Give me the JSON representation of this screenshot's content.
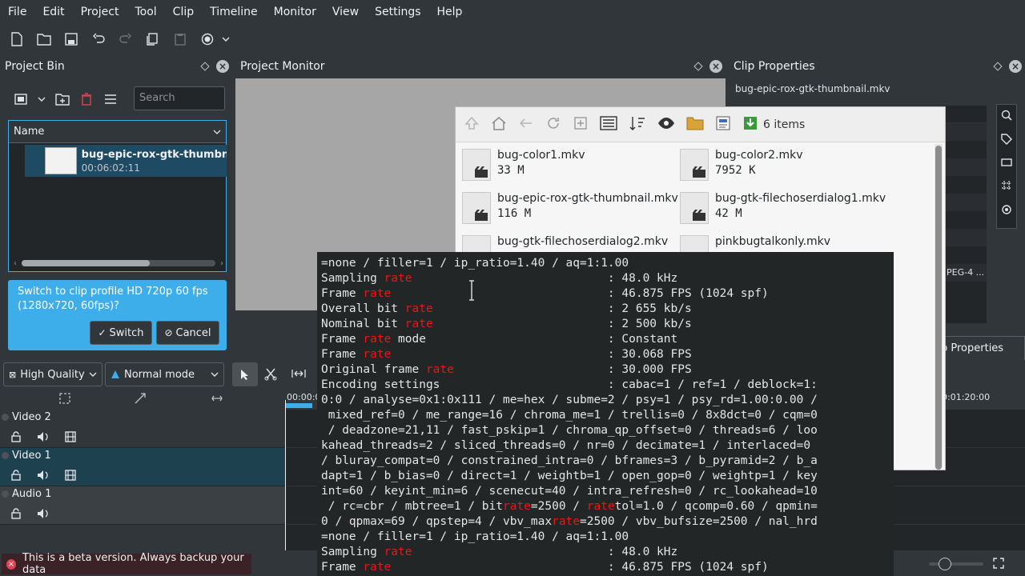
{
  "menu": [
    "File",
    "Edit",
    "Project",
    "Tool",
    "Clip",
    "Timeline",
    "Monitor",
    "View",
    "Settings",
    "Help"
  ],
  "project_bin": {
    "title": "Project Bin",
    "search_placeholder": "Search",
    "column_name": "Name",
    "clip_name": "bug-epic-rox-gtk-thumbnail",
    "clip_duration": "00:06:02:11",
    "profile_message": "Switch to clip profile HD 720p 60 fps (1280x720, 60fps)?",
    "switch_label": "Switch",
    "cancel_label": "Cancel"
  },
  "project_monitor": {
    "title": "Project Monitor"
  },
  "clip_properties": {
    "title": "Clip Properties",
    "filename": "bug-epic-rox-gtk-thumbnail.mkv",
    "tab_label": "p Properties",
    "codec_snippet": "PEG-4 ..."
  },
  "file_dialog": {
    "item_count": "6 items",
    "files": [
      {
        "name": "bug-color1.mkv",
        "size": "33 M"
      },
      {
        "name": "bug-color2.mkv",
        "size": "7952 K"
      },
      {
        "name": "bug-epic-rox-gtk-thumbnail.mkv",
        "size": "116 M"
      },
      {
        "name": "bug-gtk-filechoserdialog1.mkv",
        "size": "42 M"
      },
      {
        "name": "bug-gtk-filechoserdialog2.mkv",
        "size": ""
      },
      {
        "name": "pinkbugtalkonly.mkv",
        "size": ""
      }
    ]
  },
  "timeline": {
    "quality": "High Quality",
    "mode": "Normal mode",
    "ruler_start": "00:00:0",
    "ruler_end": "0:01:20:00",
    "tracks": [
      {
        "name": "Video 2"
      },
      {
        "name": "Video 1"
      },
      {
        "name": "Audio 1"
      }
    ]
  },
  "status": {
    "beta_message": "This is a beta version. Always backup your data"
  },
  "terminal": {
    "lines": [
      "=none / filler=1 / ip_ratio=1.40 / aq=1:1.00",
      "Sampling rate                            : 48.0 kHz",
      "Frame rate                               : 46.875 FPS (1024 spf)",
      "Overall bit rate                         : 2 655 kb/s",
      "Nominal bit rate                         : 2 500 kb/s",
      "Frame rate mode                          : Constant",
      "Frame rate                               : 30.068 FPS",
      "Original frame rate                      : 30.000 FPS",
      "Encoding settings                        : cabac=1 / ref=1 / deblock=1:",
      "0:0 / analyse=0x1:0x111 / me=hex / subme=2 / psy=1 / psy_rd=1.00:0.00 /",
      " mixed_ref=0 / me_range=16 / chroma_me=1 / trellis=0 / 8x8dct=0 / cqm=0",
      " / deadzone=21,11 / fast_pskip=1 / chroma_qp_offset=0 / threads=6 / loo",
      "kahead_threads=2 / sliced_threads=0 / nr=0 / decimate=1 / interlaced=0",
      "/ bluray_compat=0 / constrained_intra=0 / bframes=3 / b_pyramid=2 / b_a",
      "dapt=1 / b_bias=0 / direct=1 / weightb=1 / open_gop=0 / weightp=1 / key",
      "int=60 / keyint_min=6 / scenecut=40 / intra_refresh=0 / rc_lookahead=10",
      " / rc=cbr / mbtree=1 / bitrate=2500 / ratetol=1.0 / qcomp=0.60 / qpmin=",
      "0 / qpmax=69 / qpstep=4 / vbv_maxrate=2500 / vbv_bufsize=2500 / nal_hrd",
      "=none / filler=1 / ip_ratio=1.40 / aq=1:1.00",
      "Sampling rate                            : 48.0 kHz",
      "Frame rate                               : 46.875 FPS (1024 spf)"
    ],
    "highlight": "rate"
  }
}
